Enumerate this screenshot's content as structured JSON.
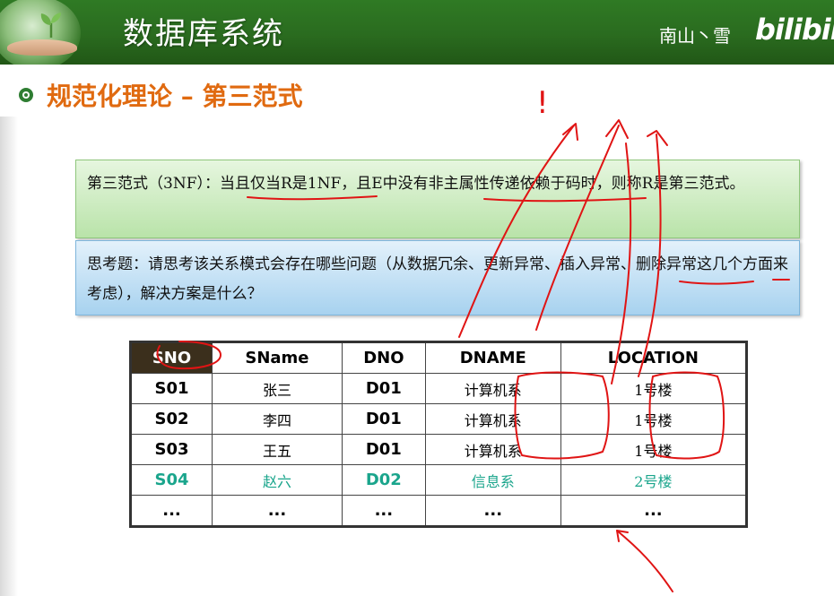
{
  "header": {
    "title": "数据库系统",
    "author": "南山丶雪",
    "brand": "bilibili",
    "colors": {
      "bar": "#2a6b1f",
      "heading": "#e06a10",
      "annotation": "#e01010"
    }
  },
  "section": {
    "heading": "规范化理论 – 第三范式"
  },
  "definition": {
    "text": "第三范式（3NF）：当且仅当R是1NF，且E中没有非主属性传递依赖于码时，则称R是第三范式。"
  },
  "question": {
    "text": "思考题：请思考该关系模式会存在哪些问题（从数据冗余、更新异常、插入异常、删除异常这几个方面来考虑），解决方案是什么？"
  },
  "annotation": {
    "mark": "!"
  },
  "table": {
    "headers": [
      "SNO",
      "SName",
      "DNO",
      "DNAME",
      "LOCATION"
    ],
    "rows": [
      [
        "S01",
        "张三",
        "D01",
        "计算机系",
        "1号楼"
      ],
      [
        "S02",
        "李四",
        "D01",
        "计算机系",
        "1号楼"
      ],
      [
        "S03",
        "王五",
        "D01",
        "计算机系",
        "1号楼"
      ],
      [
        "S04",
        "赵六",
        "D02",
        "信息系",
        "2号楼"
      ],
      [
        "...",
        "...",
        "...",
        "...",
        "..."
      ]
    ]
  }
}
